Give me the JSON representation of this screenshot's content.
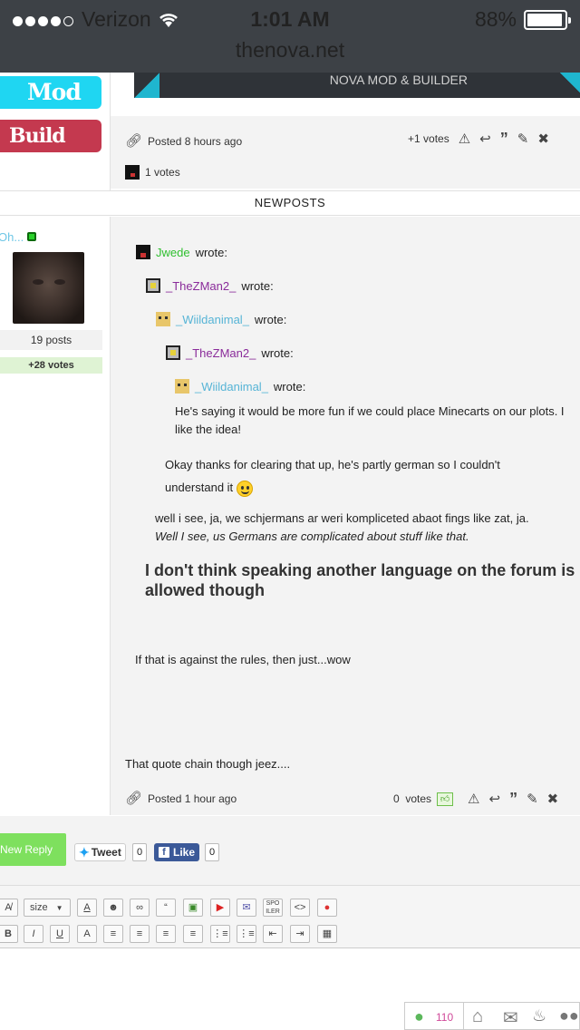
{
  "status_bar": {
    "carrier": "Verizon",
    "time": "1:01 AM",
    "battery": "88%",
    "url": "thenova.net"
  },
  "left_nav": {
    "mod_label": "Mod",
    "build_label": "Build Mgr."
  },
  "banner": {
    "text": "NOVA MOD & BUILDER"
  },
  "post1": {
    "posted": "Posted 8 hours ago",
    "votes": "+1",
    "votes_label": "votes",
    "voter_votes": "1 votes"
  },
  "section_header": "NEWPOSTS",
  "post2": {
    "username": "Oh...",
    "posts": "19 posts",
    "votes": "+28 votes",
    "quotes": [
      {
        "user": "Jwede",
        "wrote": "wrote:"
      },
      {
        "user": "_TheZMan2_",
        "wrote": "wrote:"
      },
      {
        "user": "_Wiildanimal_",
        "wrote": "wrote:"
      },
      {
        "user": "_TheZMan2_",
        "wrote": "wrote:"
      },
      {
        "user": "_Wiildanimal_",
        "wrote": "wrote:"
      }
    ],
    "innermost_text": "He's saying it would be more fun if we could place Minecarts on our plots. I like the idea!",
    "reply_4": "Okay thanks for clearing that up, he's partly german so I couldn't understand it",
    "reply_3_line1": "well i see, ja, we schjermans ar weri kompliceted abaot fings like zat, ja.",
    "reply_3_line2": "Well I see, us Germans are complicated about stuff like that.",
    "reply_2_bold": "I don't think speaking another language on the forum is allowed though",
    "reply_1": "If that is against the rules, then just...wow",
    "body": "That quote chain though jeez....",
    "posted": "Posted 1 hour ago",
    "vote_count": "0",
    "votes_label": "votes"
  },
  "actions": {
    "new_reply": "New Reply",
    "tweet": "Tweet",
    "tweet_count": "0",
    "like": "Like",
    "like_count": "0"
  },
  "editor": {
    "size_label": "size"
  },
  "footer": {
    "online_count": "110"
  }
}
